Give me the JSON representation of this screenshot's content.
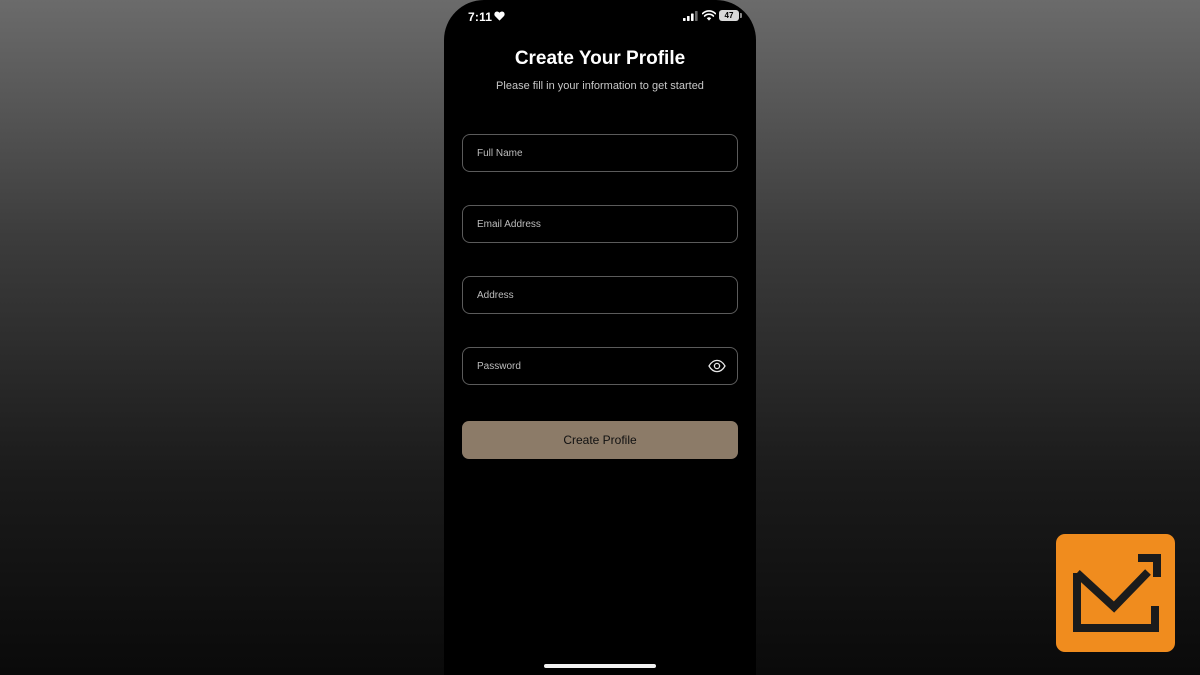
{
  "status_bar": {
    "time": "7:11",
    "battery_level": "47",
    "icons": [
      "heart-icon",
      "signal-icon",
      "wifi-icon",
      "battery-icon"
    ]
  },
  "page": {
    "title": "Create Your Profile",
    "subtitle": "Please fill in your information to get started"
  },
  "form": {
    "full_name": {
      "placeholder": "Full Name",
      "value": ""
    },
    "email": {
      "placeholder": "Email Address",
      "value": ""
    },
    "address": {
      "placeholder": "Address",
      "value": ""
    },
    "password": {
      "placeholder": "Password",
      "value": "",
      "toggle_icon": "eye-icon"
    },
    "submit_label": "Create Profile"
  },
  "colors": {
    "background_top": "#6b6b6b",
    "background_bottom": "#0a0a0a",
    "screen": "#000000",
    "field_border": "#5b5b5b",
    "button": "#8c7b68",
    "logo_badge": "#f08c1e"
  },
  "logo": {
    "icon": "mail-arrow-logo-icon"
  }
}
